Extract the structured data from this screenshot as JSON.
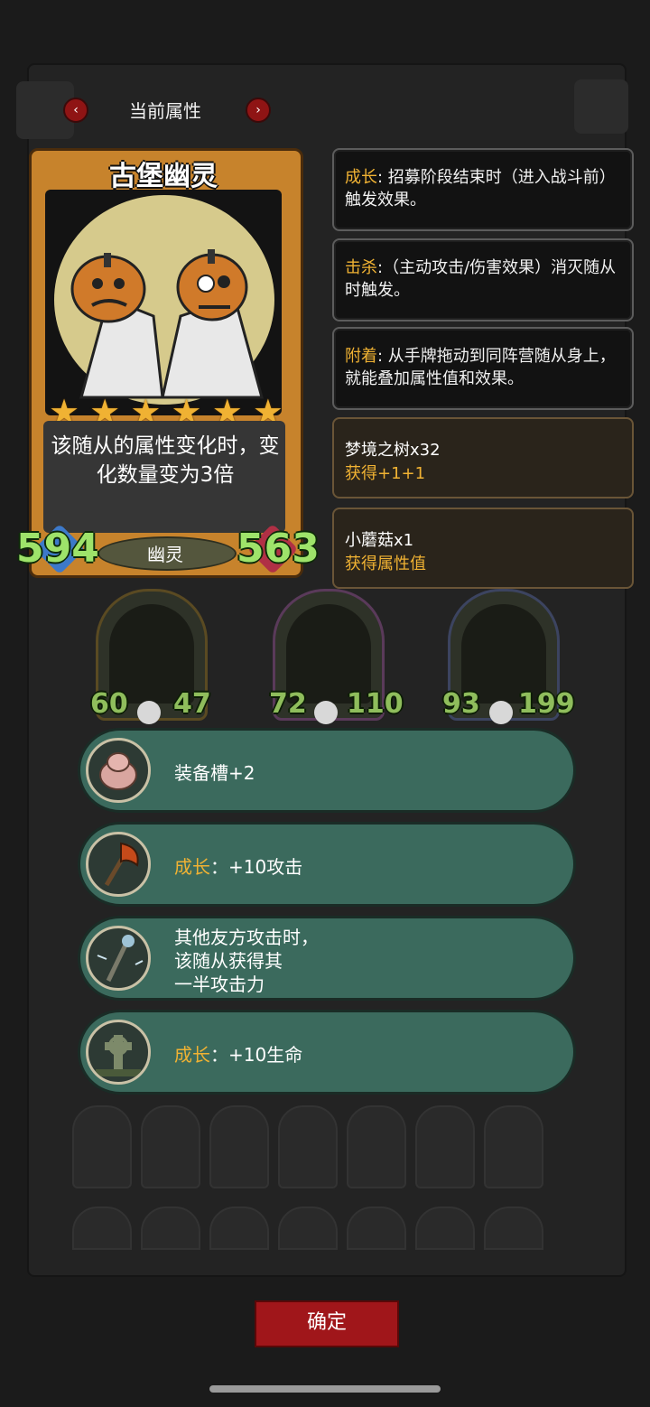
{
  "header": {
    "title": "当前属性"
  },
  "card": {
    "name": "古堡幽灵",
    "stars": 6,
    "description": "该随从的属性变化时，变化数量变为3倍",
    "race": "幽灵",
    "attack": "594",
    "health": "563"
  },
  "keywords": [
    {
      "key": "成长",
      "text": ": 招募阶段结束时（进入战斗前）触发效果。"
    },
    {
      "key": "击杀",
      "text": ":（主动攻击/伤害效果）消灭随从时触发。"
    },
    {
      "key": "附着",
      "text": ": 从手牌拖动到同阵营随从身上，就能叠加属性值和效果。"
    }
  ],
  "items": [
    {
      "name": "梦境之树x32",
      "effect": "获得+1+1"
    },
    {
      "name": "小蘑菇x1",
      "effect": "获得属性值"
    }
  ],
  "minions": [
    {
      "attack": "60",
      "health": "47"
    },
    {
      "attack": "72",
      "health": "110"
    },
    {
      "attack": "93",
      "health": "199"
    }
  ],
  "abilities": [
    {
      "key": "",
      "text": "装备槽+2",
      "icon": "pig-icon"
    },
    {
      "key": "成长",
      "text": "：+10攻击",
      "icon": "axe-icon"
    },
    {
      "key": "",
      "text": "其他友方攻击时，该随从获得其一半攻击力",
      "icon": "scepter-icon",
      "lines": [
        "其他友方攻击时，",
        "该随从获得其",
        "一半攻击力"
      ]
    },
    {
      "key": "成长",
      "text": "：+10生命",
      "icon": "gravestone-icon"
    }
  ],
  "footer": {
    "confirm_label": "确定"
  },
  "colors": {
    "accent_gold": "#f0b233",
    "stat_green": "#9ee36a",
    "ability_teal": "#3b6a5d",
    "confirm_red": "#a0161a"
  }
}
